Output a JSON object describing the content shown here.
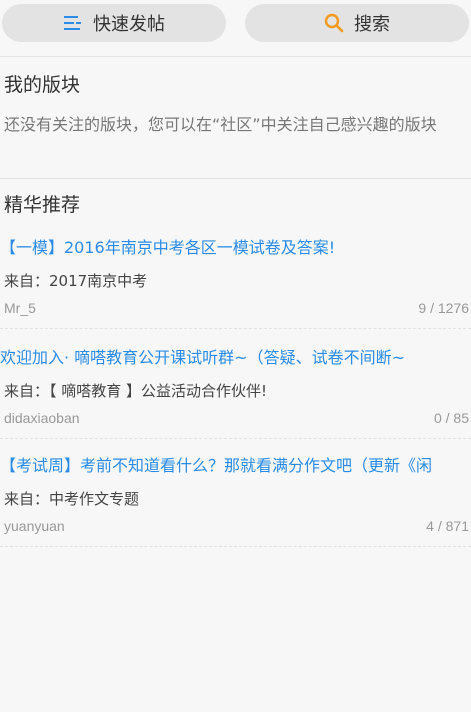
{
  "topbar": {
    "post_label": "快速发帖",
    "search_label": "搜索",
    "post_icon": "list-icon",
    "search_icon": "search-icon",
    "post_icon_color": "#2a8ce6",
    "search_icon_color": "#f39a1e"
  },
  "my_boards": {
    "title": "我的版块",
    "empty_text": "还没有关注的版块，您可以在“社区”中关注自己感兴趣的版块"
  },
  "featured": {
    "title": "精华推荐",
    "posts": [
      {
        "title": "【一模】2016年南京中考各区一模试卷及答案!",
        "source": "来自：2017南京中考",
        "author": "Mr_5",
        "count": "9 / 1276"
      },
      {
        "title": "欢迎加入· 嘀嗒教育公开课试听群~（答疑、试卷不间断~",
        "source": "来自：【 嘀嗒教育 】公益活动合作伙伴!",
        "author": "didaxiaoban",
        "count": "0 / 85"
      },
      {
        "title": "【考试周】考前不知道看什么？那就看满分作文吧（更新《闲",
        "source": "来自：中考作文专题",
        "author": "yuanyuan",
        "count": "4 / 871"
      }
    ]
  },
  "colors": {
    "link": "#2a8ce6",
    "background": "#f7f7f7"
  }
}
